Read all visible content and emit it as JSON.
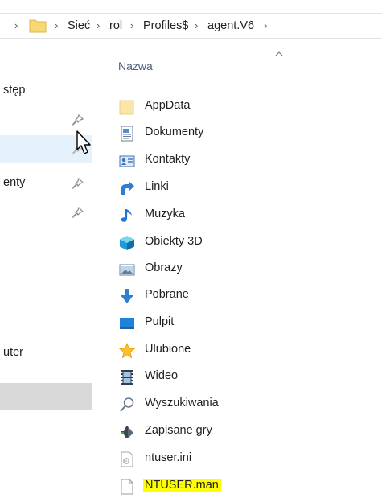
{
  "addressbar": {
    "crumbs": [
      "Sieć",
      "rol",
      "Profiles$",
      "agent.V6"
    ],
    "separator": "›"
  },
  "navpane": {
    "items": [
      {
        "label": "stęp",
        "pinned": false
      },
      {
        "label": "",
        "pinned": true
      },
      {
        "label": "",
        "pinned": false
      },
      {
        "label": "enty",
        "pinned": true
      },
      {
        "label": "",
        "pinned": true
      },
      {
        "label": "uter",
        "pinned": false
      }
    ]
  },
  "list": {
    "column_name": "Nazwa",
    "files": [
      {
        "name": "AppData",
        "icon": "folder-icon"
      },
      {
        "name": "Dokumenty",
        "icon": "documents-icon"
      },
      {
        "name": "Kontakty",
        "icon": "contacts-icon"
      },
      {
        "name": "Linki",
        "icon": "links-icon"
      },
      {
        "name": "Muzyka",
        "icon": "music-icon"
      },
      {
        "name": "Obiekty 3D",
        "icon": "objects-3d-icon"
      },
      {
        "name": "Obrazy",
        "icon": "pictures-icon"
      },
      {
        "name": "Pobrane",
        "icon": "downloads-icon"
      },
      {
        "name": "Pulpit",
        "icon": "desktop-icon"
      },
      {
        "name": "Ulubione",
        "icon": "favorites-icon"
      },
      {
        "name": "Wideo",
        "icon": "videos-icon"
      },
      {
        "name": "Wyszukiwania",
        "icon": "searches-icon"
      },
      {
        "name": "Zapisane gry",
        "icon": "saved-games-icon"
      },
      {
        "name": "ntuser.ini",
        "icon": "ini-file-icon"
      },
      {
        "name": "NTUSER.man",
        "icon": "file-icon",
        "highlighted": true
      }
    ]
  },
  "colors": {
    "folder": "#f8d775",
    "hover": "#e5f1fb",
    "highlight": "#ffff00",
    "header_text": "#4c607a"
  }
}
